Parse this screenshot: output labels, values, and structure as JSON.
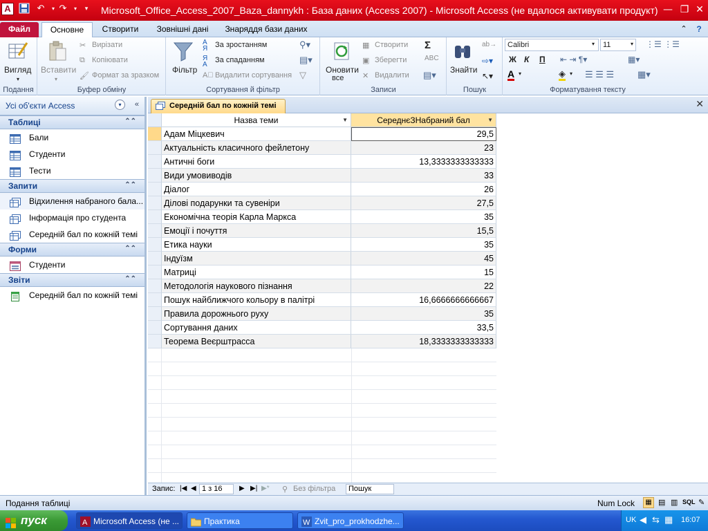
{
  "window": {
    "title": "Microsoft_Office_Access_2007_Baza_dannykh : База даних (Access 2007)  -  Microsoft Access (не вдалося активувати продукт)"
  },
  "ribbon_tabs": [
    {
      "label": "Файл"
    },
    {
      "label": "Основне"
    },
    {
      "label": "Створити"
    },
    {
      "label": "Зовнішні дані"
    },
    {
      "label": "Знаряддя бази даних"
    }
  ],
  "ribbon": {
    "views": {
      "view_label": "Вигляд",
      "group": "Подання"
    },
    "clipboard": {
      "paste": "Вставити",
      "cut": "Вирізати",
      "copy": "Копіювати",
      "format_painter": "Формат за зразком",
      "group": "Буфер обміну"
    },
    "sort_filter": {
      "filter": "Фільтр",
      "ascending": "За зростанням",
      "descending": "За спаданням",
      "remove_sort": "Видалити сортування",
      "group": "Сортування й фільтр"
    },
    "records": {
      "refresh": "Оновити",
      "refresh_all": "все",
      "new": "Створити",
      "save": "Зберегти",
      "delete": "Видалити",
      "totals": "Σ",
      "group": "Записи"
    },
    "find": {
      "find": "Знайти",
      "group": "Пошук"
    },
    "text_format": {
      "font": "Calibri",
      "size": "11",
      "bold": "Ж",
      "italic": "К",
      "underline": "П",
      "group": "Форматування тексту"
    }
  },
  "nav_pane": {
    "title": "Усі об'єкти Access",
    "sections": [
      {
        "label": "Таблиці",
        "items": [
          "Бали",
          "Студенти",
          "Тести"
        ]
      },
      {
        "label": "Запити",
        "items": [
          "Відхилення набраного бала...",
          "Інформація про студента",
          "Середній бал по кожній темі"
        ]
      },
      {
        "label": "Форми",
        "items": [
          "Студенти"
        ]
      },
      {
        "label": "Звіти",
        "items": [
          "Середній бал по кожній темі"
        ]
      }
    ]
  },
  "document": {
    "tab_title": "Середній бал по кожній темі",
    "columns": [
      "Назва теми",
      "СереднєЗНабраний бал"
    ],
    "rows": [
      [
        "Адам Міцкевич",
        "29,5"
      ],
      [
        "Актуальність класичного фейлетону",
        "23"
      ],
      [
        "Античні боги",
        "13,3333333333333"
      ],
      [
        "Види умовиводів",
        "33"
      ],
      [
        "Діалог",
        "26"
      ],
      [
        "Ділові подарунки та сувеніри",
        "27,5"
      ],
      [
        "Економічна теорія Карла Маркса",
        "35"
      ],
      [
        "Емоції і почуття",
        "15,5"
      ],
      [
        "Етика науки",
        "35"
      ],
      [
        "Індуїзм",
        "45"
      ],
      [
        "Матриці",
        "15"
      ],
      [
        "Методологія наукового пізнання",
        "22"
      ],
      [
        "Пошук найближчого кольору в палітрі",
        "16,6666666666667"
      ],
      [
        "Правила дорожнього руху",
        "35"
      ],
      [
        "Сортування даних",
        "33,5"
      ],
      [
        "Теорема Веєрштрасса",
        "18,3333333333333"
      ]
    ]
  },
  "record_nav": {
    "label": "Запис:",
    "position": "1 з 16",
    "filter": "Без фільтра",
    "search": "Пошук"
  },
  "status": {
    "left": "Подання таблиці",
    "numlock": "Num Lock",
    "sql": "SQL"
  },
  "taskbar": {
    "start": "пуск",
    "tasks": [
      {
        "label": "Microsoft Access (не ..."
      },
      {
        "label": "Практика"
      },
      {
        "label": "Zvit_pro_prokhodzhe..."
      }
    ],
    "lang": "UK",
    "time": "16:07"
  },
  "colors": {
    "title_bar": "#e0101c",
    "file_tab": "#c0143c",
    "taskbar": "#2458d0",
    "start": "#3a9a35",
    "active_tab": "#ffd98a"
  }
}
